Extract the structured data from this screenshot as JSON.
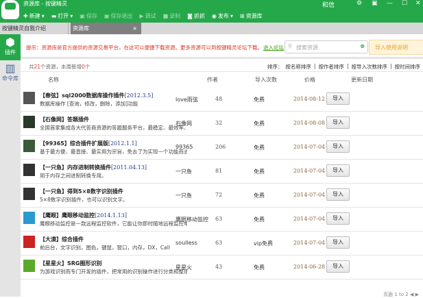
{
  "window": {
    "title": "资源库 - 按键精灵",
    "user": "和信",
    "controls": [
      "⚙",
      "▣",
      "—",
      "☐",
      "✕"
    ]
  },
  "toolbar": [
    {
      "label": "新建",
      "icon": "plus-icon",
      "enabled": true
    },
    {
      "label": "打开",
      "icon": "folder-icon",
      "enabled": true
    },
    {
      "label": "保存",
      "icon": "save-icon",
      "enabled": false
    },
    {
      "label": "保存退出",
      "icon": "save-exit-icon",
      "enabled": false
    },
    {
      "label": "调试",
      "icon": "play-icon",
      "enabled": false
    },
    {
      "label": "录制",
      "icon": "record-icon",
      "enabled": false
    },
    {
      "label": "抓抓",
      "icon": "capture-icon",
      "enabled": true
    },
    {
      "label": "发布",
      "icon": "publish-icon",
      "enabled": true
    },
    {
      "label": "资源库",
      "icon": "library-icon",
      "enabled": true
    }
  ],
  "tabs": [
    {
      "label": "按键精灵自我介绍"
    },
    {
      "label": "资源库",
      "close": "×"
    }
  ],
  "sidebar": [
    {
      "label": "插件"
    },
    {
      "label": "命令库"
    }
  ],
  "notice": {
    "message": "提示：资源库是官方提供的资源交易平台，在这可以便捷下载资源。更多资源可以到按键精灵论坛下载。",
    "link": "进入论坛",
    "search_placeholder": "搜索资源",
    "guide": "导入使用说明"
  },
  "summary": {
    "prefix": "共",
    "total": "21",
    "mid": "个资源，本周新增",
    "new": "0",
    "suffix": "个"
  },
  "sort": {
    "label": "排序：",
    "options": [
      "按名称排序",
      "按作者排序",
      "按导入次数排序",
      "按时间排序"
    ]
  },
  "columns": [
    "名称",
    "作者",
    "导入次数",
    "价格",
    "更新日期"
  ],
  "rows": [
    {
      "author_tag": "【春弦】",
      "title": "sql2000数据库操作插件",
      "version": "[2012.3.5]",
      "desc": "数据库操作 [查询，修改，删除，添加]功能",
      "author": "love雨弦",
      "count": "48",
      "price": "免费",
      "date": "2014-08-12",
      "color": "#555"
    },
    {
      "author_tag": "【石像网】",
      "title": "答题插件",
      "version": "",
      "desc": "全国首家集成各大代答商资源的答题服务平台，最稳定、最效率、性",
      "author": "石像网",
      "count": "32",
      "price": "免费",
      "date": "2014-08-08",
      "color": "#2a3a2a"
    },
    {
      "author_tag": "【99365】",
      "title": "综合插件扩展版",
      "version": "[2012.1.1]",
      "desc": "基于最方便、最直接、最实用为宗旨，免去了为实现一个功能而去写",
      "author": "99365",
      "count": "206",
      "price": "免费",
      "date": "2014-07-04",
      "color": "#3a5a3a"
    },
    {
      "author_tag": "【一只鱼】",
      "title": "内存进制转换插件",
      "version": "[2011.04.13]",
      "desc": "用于内存之间进制转换专用。",
      "author": "一只鱼",
      "count": "81",
      "price": "免费",
      "date": "2014-07-04",
      "color": "#333"
    },
    {
      "author_tag": "【一只鱼】",
      "title": "得到5×8数字识别插件",
      "version": "",
      "desc": "5×8数字识别插件，也可以识别文字。",
      "author": "一只鱼",
      "count": "72",
      "price": "免费",
      "date": "2014-07-04",
      "color": "#333"
    },
    {
      "author_tag": "【鹰眼】",
      "title": "鹰眼移动监控",
      "version": "[2014.1.13]",
      "desc": "鹰眼移动监控是一款远程监控软件，它能让你即时随地远程监控电",
      "author": "鹰眼移动监控",
      "count": "63",
      "price": "免费",
      "date": "2014-07-04",
      "color": "#2a9ad0"
    },
    {
      "author_tag": "【大漠】",
      "title": "综合插件",
      "version": "",
      "desc": "前后台，文字识别，图色，键鼠，窗口，内存，DX，Call",
      "author": "soulless",
      "count": "63",
      "price": "vip免费",
      "date": "2014-07-04",
      "color": "#c22"
    },
    {
      "author_tag": "【星星火】",
      "title": "SRG图形识别",
      "version": "",
      "desc": "为游戏识别而专门开发的插件，把常用的识别操作进行分类和整理，",
      "author": "星星火",
      "count": "43",
      "price": "免费",
      "date": "2014-06-28",
      "color": "#5aaa2a"
    }
  ],
  "import_label": "导入",
  "pager": {
    "text": "页面 1 to 2",
    "prev": "◀",
    "next": "▶"
  }
}
